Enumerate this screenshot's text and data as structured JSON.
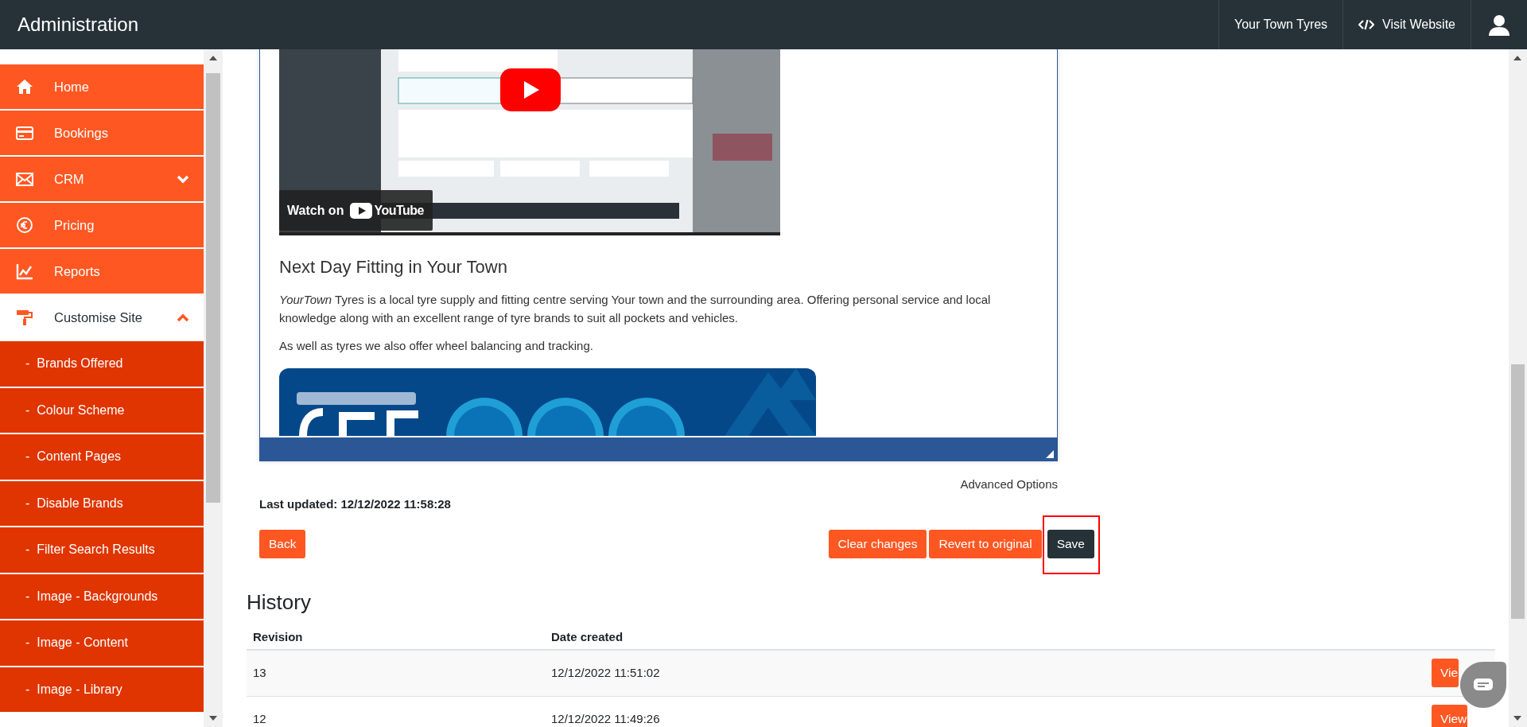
{
  "navbar": {
    "title": "Administration",
    "site_name": "Your Town Tyres",
    "visit_link": "Visit Website"
  },
  "sidebar": {
    "items": [
      {
        "label": "Home",
        "selected": false
      },
      {
        "label": "Bookings",
        "selected": false
      },
      {
        "label": "CRM",
        "selected": false,
        "expanded": false
      },
      {
        "label": "Pricing",
        "selected": false
      },
      {
        "label": "Reports",
        "selected": false
      },
      {
        "label": "Customise Site",
        "selected": true,
        "expanded": true,
        "children": [
          {
            "label": "-  Brands Offered",
            "selected": false
          },
          {
            "label": "-  Colour Scheme",
            "selected": false
          },
          {
            "label": "-  Content Pages",
            "selected": false
          },
          {
            "label": "-  Disable Brands",
            "selected": false
          },
          {
            "label": "-  Filter Search Results",
            "selected": false
          },
          {
            "label": "-  Image - Backgrounds",
            "selected": false
          },
          {
            "label": "-  Image - Content",
            "selected": false
          },
          {
            "label": "-  Image - Library",
            "selected": false
          }
        ]
      }
    ]
  },
  "editor": {
    "video": {
      "overlay_text": "Watch on",
      "brand": "YouTube"
    },
    "heading": "Next Day Fitting in Your Town",
    "paragraphs": [
      "*YourTown* Tyres is a local tyre supply and fitting centre serving Your town and the surrounding area. Offering personal service and local knowledge along with an excellent range of tyre brands to suit all pockets and vehicles.",
      "As well as tyres we also offer wheel balancing and tracking."
    ]
  },
  "advanced_options": "Advanced Options",
  "last_updated": "Last updated: 12/12/2022 11:58:28",
  "buttons": [
    {
      "label": "Back",
      "kind": "primary",
      "highlighted": false
    },
    {
      "label": "Clear changes",
      "kind": "primary",
      "highlighted": false
    },
    {
      "label": "Revert to original",
      "kind": "primary",
      "highlighted": false
    },
    {
      "label": "Save",
      "kind": "dark",
      "highlighted": true
    }
  ],
  "history": {
    "title": "History",
    "columns": [
      "Revision",
      "Date created"
    ],
    "rows": [
      {
        "revision": "13",
        "date_created": "12/12/2022 11:51:02",
        "action": "Vie"
      },
      {
        "revision": "12",
        "date_created": "12/12/2022 11:49:26",
        "action": "View"
      }
    ]
  }
}
